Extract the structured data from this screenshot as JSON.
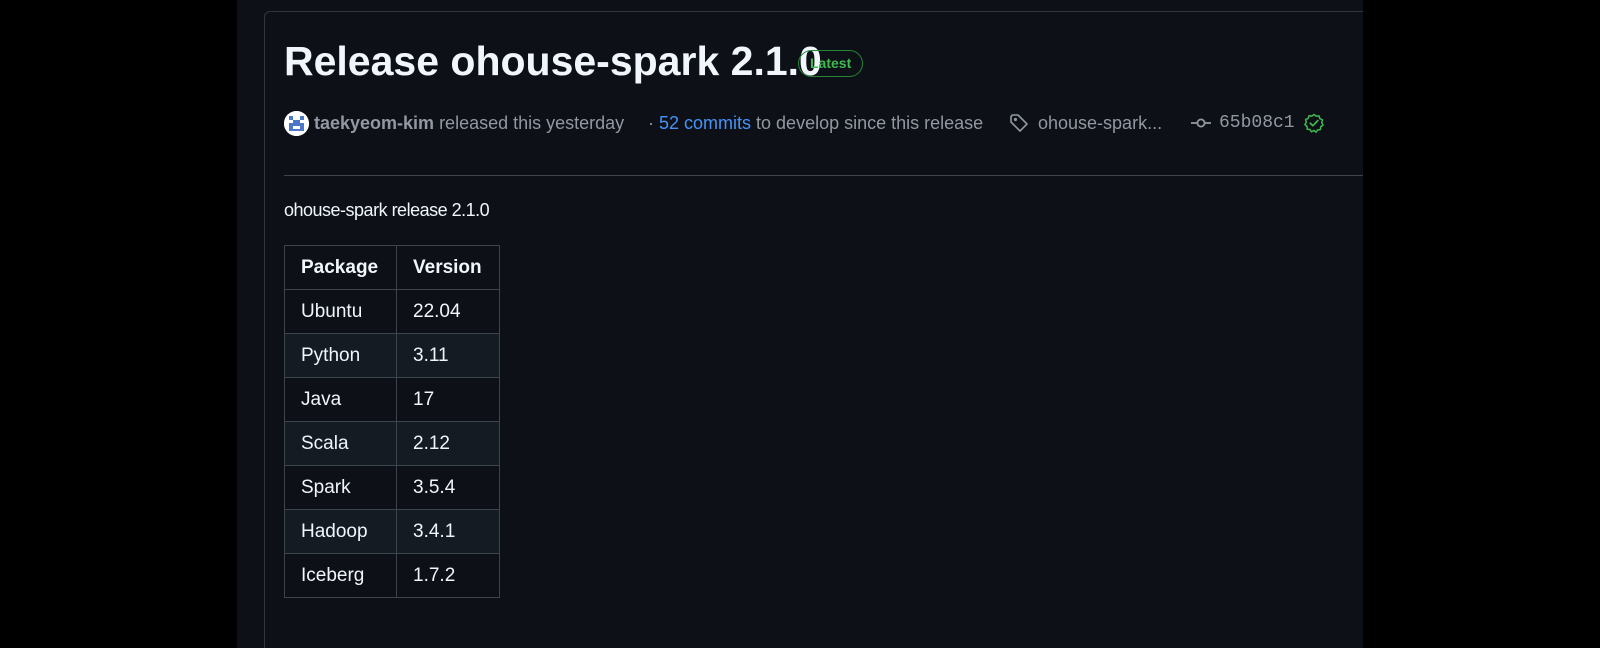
{
  "release": {
    "title": "Release ohouse-spark 2.1.0",
    "badge": "Latest",
    "author": "taekyeom-kim",
    "released_text": "released this yesterday",
    "commits_prefix": "·",
    "commits_link": "52 commits",
    "commits_suffix": "to develop since this release",
    "tag": "ohouse-spark...",
    "commit_sha": "65b08c1",
    "description": "ohouse-spark release 2.1.0"
  },
  "table": {
    "headers": [
      "Package",
      "Version"
    ],
    "rows": [
      [
        "Ubuntu",
        "22.04"
      ],
      [
        "Python",
        "3.11"
      ],
      [
        "Java",
        "17"
      ],
      [
        "Scala",
        "2.12"
      ],
      [
        "Spark",
        "3.5.4"
      ],
      [
        "Hadoop",
        "3.4.1"
      ],
      [
        "Iceberg",
        "1.7.2"
      ]
    ]
  },
  "icons": {
    "avatar": "avatar-identicon",
    "tag": "tag-icon",
    "commit": "git-commit-icon",
    "verified": "check-circle-icon"
  },
  "colors": {
    "background": "#0d1117",
    "text": "#f0f6fc",
    "muted": "#9198a1",
    "link": "#4493f8",
    "success": "#3fb950",
    "border": "#3d444d"
  }
}
